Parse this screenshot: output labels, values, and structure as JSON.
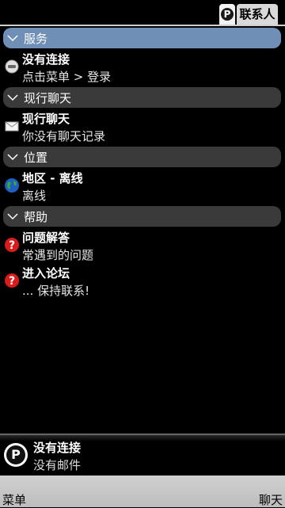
{
  "tabs": {
    "p_label": "P",
    "contacts_label": "联系人"
  },
  "sections": [
    {
      "header": "服务",
      "active": true,
      "items": [
        {
          "title": "没有连接",
          "sub": "点击菜单 > 登录",
          "icon": "chat-bubble-icon"
        }
      ]
    },
    {
      "header": "现行聊天",
      "active": false,
      "items": [
        {
          "title": "现行聊天",
          "sub": "你没有聊天记录",
          "icon": "envelope-icon"
        }
      ]
    },
    {
      "header": "位置",
      "active": false,
      "items": [
        {
          "title": "地区 - 离线",
          "sub": "离线",
          "icon": "globe-icon"
        }
      ]
    },
    {
      "header": "帮助",
      "active": false,
      "items": [
        {
          "title": "问题解答",
          "sub": "常遇到的问题",
          "icon": "help-icon"
        },
        {
          "title": "进入论坛",
          "sub": "... 保持联系!",
          "icon": "help-icon"
        }
      ]
    }
  ],
  "status": {
    "avatar_letter": "P",
    "line1": "没有连接",
    "line2": "没有邮件"
  },
  "softkeys": {
    "left": "菜单",
    "right": "聊天"
  }
}
